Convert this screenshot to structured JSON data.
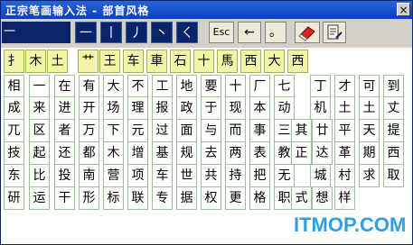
{
  "window": {
    "title": "正宗笔画输入法 - 部首风格",
    "close_label": "×"
  },
  "toolbar": {
    "input_value": "一",
    "strokes": [
      "一",
      "丨",
      "丿",
      "丶",
      "ㄑ"
    ],
    "esc_label": "Esc",
    "back_label": "←",
    "dot_label": "。"
  },
  "radicals": [
    "扌",
    "木",
    "土",
    "艹",
    "王",
    "车",
    "車",
    "石",
    "十",
    "馬",
    "西",
    "大",
    "西"
  ],
  "rows": [
    [
      "相",
      "一",
      "在",
      "有",
      "大",
      "不",
      "工",
      "地",
      "要",
      "十",
      "厂",
      "七",
      "丁",
      "才",
      "可",
      "到"
    ],
    [
      "成",
      "来",
      "进",
      "开",
      "场",
      "理",
      "报",
      "政",
      "于",
      "现",
      "本",
      "动",
      "机",
      "土",
      "土",
      "丈"
    ],
    [
      "兀",
      "区",
      "者",
      "万",
      "下",
      "元",
      "过",
      "面",
      "与",
      "而",
      "事",
      "三",
      "其",
      "廿",
      "平",
      "天",
      "提"
    ],
    [
      "技",
      "起",
      "还",
      "都",
      "木",
      "增",
      "基",
      "规",
      "去",
      "两",
      "表",
      "教",
      "正",
      "达",
      "革",
      "期",
      "西"
    ],
    [
      "东",
      "比",
      "投",
      "南",
      "营",
      "项",
      "车",
      "世",
      "共",
      "持",
      "把",
      "无",
      "城",
      "村",
      "求",
      "取",
      "原"
    ],
    [
      "研",
      "运",
      "干",
      "形",
      "标",
      "联",
      "专",
      "据",
      "权",
      "更",
      "格",
      "职",
      "式",
      "想",
      "样"
    ]
  ],
  "watermark": "ITMOP.COM"
}
